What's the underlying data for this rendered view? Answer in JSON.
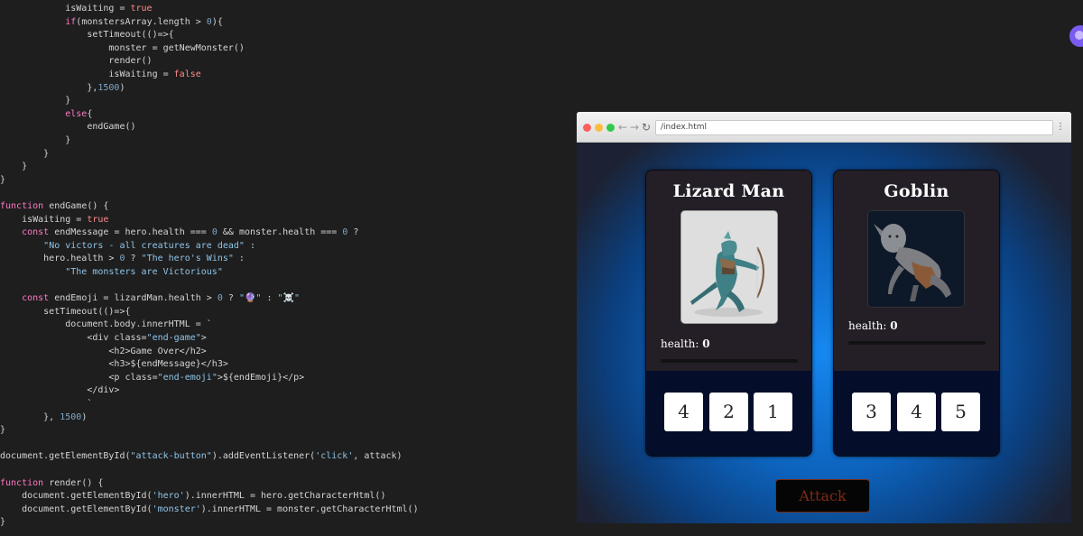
{
  "code_lines": [
    "            isWaiting = true",
    "            if(monstersArray.length > 0){",
    "                setTimeout(()=>{",
    "                    monster = getNewMonster()",
    "                    render()",
    "                    isWaiting = false",
    "                },1500)",
    "            }",
    "            else{",
    "                endGame()",
    "            }",
    "        }",
    "    }",
    "}",
    "",
    "function endGame() {",
    "    isWaiting = true",
    "    const endMessage = hero.health === 0 && monster.health === 0 ?",
    "        \"No victors - all creatures are dead\" :",
    "        hero.health > 0 ? \"The hero's Wins\" :",
    "            \"The monsters are Victorious\"",
    "",
    "    const endEmoji = lizardMan.health > 0 ? \"🔮\" : \"☠️\"",
    "        setTimeout(()=>{",
    "            document.body.innerHTML = `",
    "                <div class=\"end-game\">",
    "                    <h2>Game Over</h2>",
    "                    <h3>${endMessage}</h3>",
    "                    <p class=\"end-emoji\">${endEmoji}</p>",
    "                </div>",
    "                `",
    "        }, 1500)",
    "}",
    "",
    "document.getElementById(\"attack-button\").addEventListener('click', attack)",
    "",
    "function render() {",
    "    document.getElementById('hero').innerHTML = hero.getCharacterHtml()",
    "    document.getElementById('monster').innerHTML = monster.getCharacterHtml()",
    "}"
  ],
  "browser": {
    "url": "/index.html",
    "back_icon": "←",
    "forward_icon": "→",
    "reload_icon": "↻",
    "menu_icon": "⋮"
  },
  "hero": {
    "name": "Lizard Man",
    "health_label": "health:",
    "health_value": "0",
    "health_fraction": 0,
    "dice": [
      "4",
      "2",
      "1"
    ]
  },
  "monster": {
    "name": "Goblin",
    "health_label": "health:",
    "health_value": "0",
    "health_fraction": 0,
    "dice": [
      "3",
      "4",
      "5"
    ]
  },
  "attack_label": "Attack",
  "colors": {
    "accent_blue": "#1687f0",
    "attack_text": "#7c2b14",
    "card_bg": "#241f26",
    "dice_panel": "#040e2b"
  }
}
